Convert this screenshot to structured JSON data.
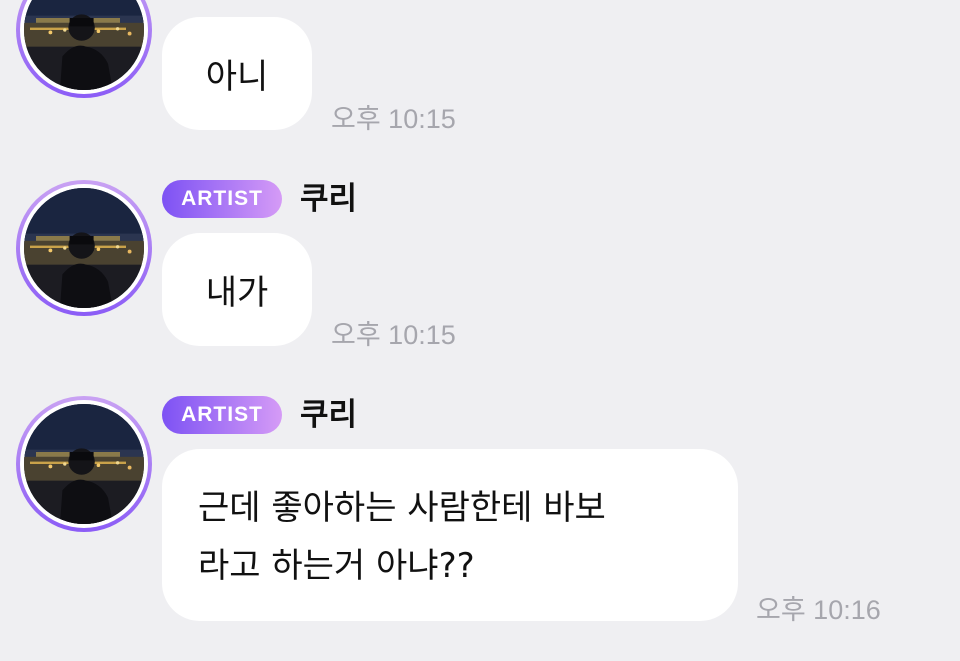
{
  "colors": {
    "background": "#efeff2",
    "bubble": "#ffffff",
    "badge_start": "#7d52f4",
    "badge_end": "#d59bf6",
    "timestamp": "#a6a6ad",
    "avatar_ring": "#8b5cf6"
  },
  "messages": [
    {
      "avatar_icon": "profile-photo",
      "text": "아니",
      "time": "오후 10:15"
    },
    {
      "badge": "ARTIST",
      "sender": "쿠리",
      "avatar_icon": "profile-photo",
      "text": "내가",
      "time": "오후 10:15"
    },
    {
      "badge": "ARTIST",
      "sender": "쿠리",
      "avatar_icon": "profile-photo",
      "text_lines": [
        "근데 좋아하는 사람한테 바보",
        "라고 하는거 아냐??"
      ],
      "time": "오후 10:16"
    }
  ]
}
